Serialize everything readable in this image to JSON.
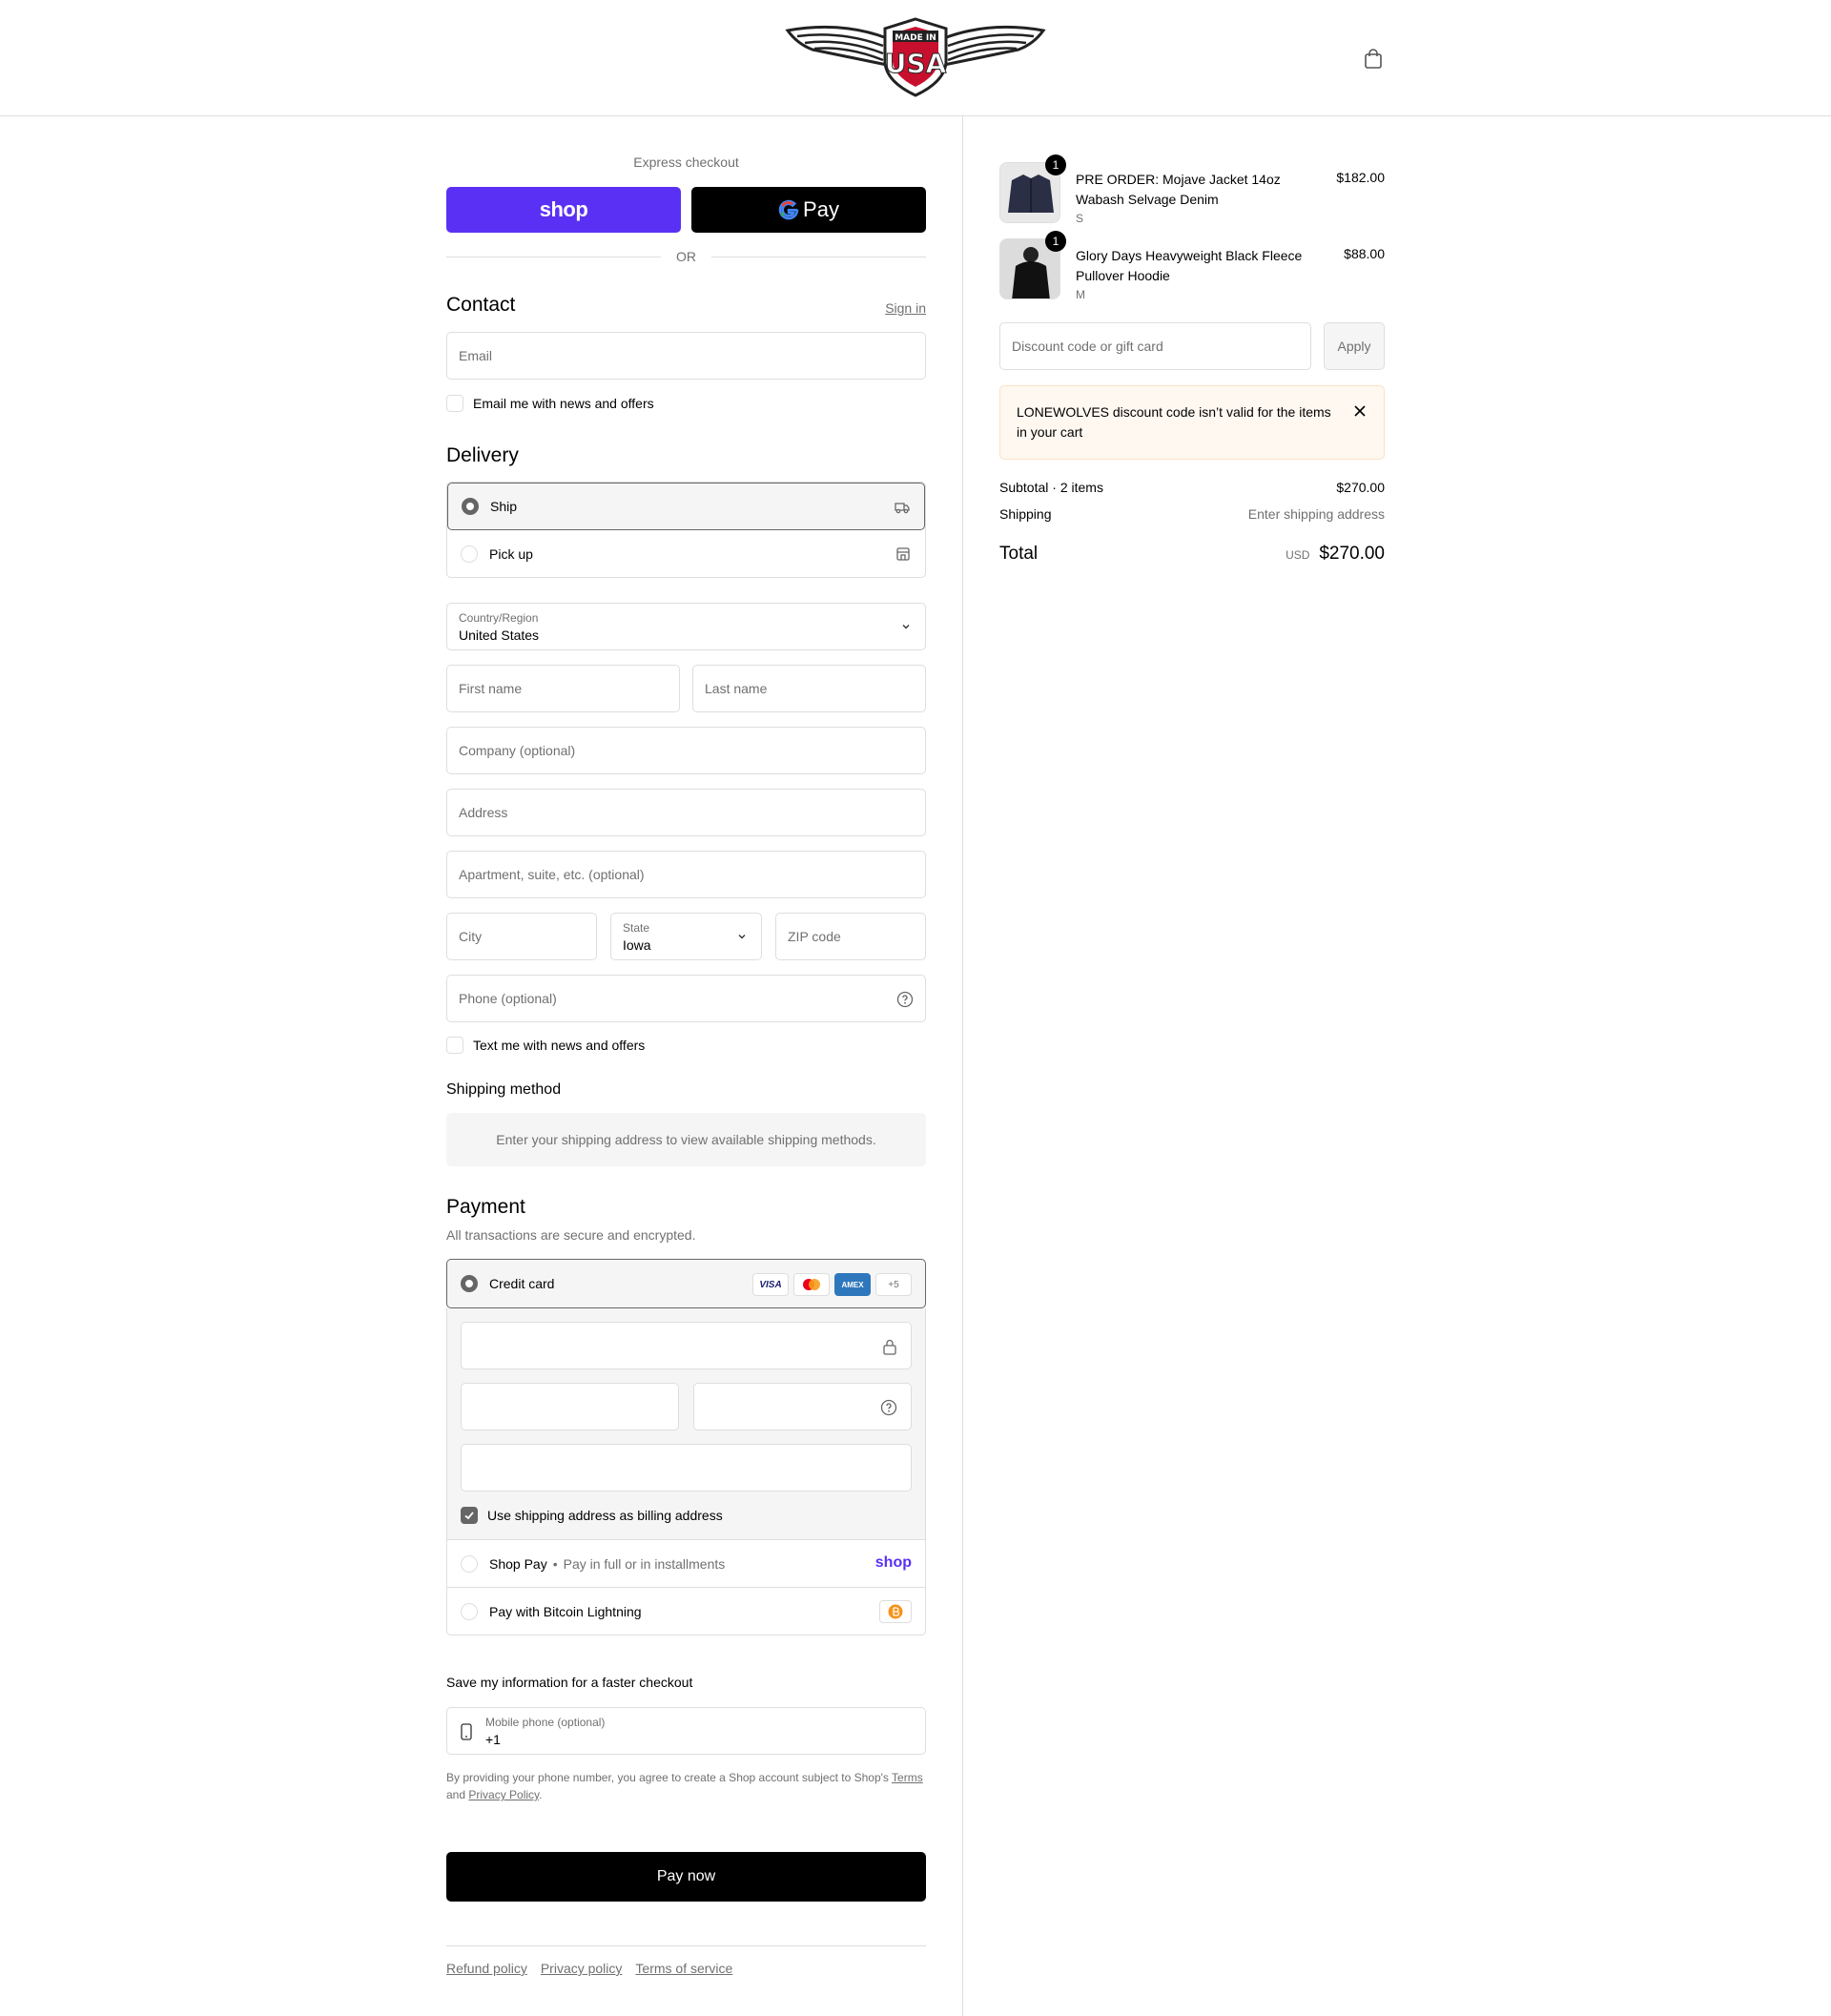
{
  "header": {
    "logo_text": "MADE IN USA"
  },
  "express": {
    "title": "Express checkout",
    "shop_label": "shop",
    "gpay_label": "Pay",
    "or_label": "OR"
  },
  "contact": {
    "title": "Contact",
    "sign_in": "Sign in",
    "email_placeholder": "Email",
    "news_label": "Email me with news and offers"
  },
  "delivery": {
    "title": "Delivery",
    "options": [
      {
        "label": "Ship",
        "selected": true,
        "icon": "truck-icon"
      },
      {
        "label": "Pick up",
        "selected": false,
        "icon": "store-icon"
      }
    ],
    "country_label": "Country/Region",
    "country_value": "United States",
    "first_name": "First name",
    "last_name": "Last name",
    "company": "Company (optional)",
    "address": "Address",
    "apartment": "Apartment, suite, etc. (optional)",
    "city": "City",
    "state_label": "State",
    "state_value": "Iowa",
    "zip": "ZIP code",
    "phone": "Phone (optional)",
    "text_label": "Text me with news and offers"
  },
  "shipping_method": {
    "title": "Shipping method",
    "message": "Enter your shipping address to view available shipping methods."
  },
  "payment": {
    "title": "Payment",
    "subtitle": "All transactions are secure and encrypted.",
    "credit_card": "Credit card",
    "cards": [
      "VISA",
      "MC",
      "AMEX",
      "+5"
    ],
    "billing_label": "Use shipping address as billing address",
    "shop_pay": "Shop Pay",
    "shop_pay_sub": "Pay in full or in installments",
    "shop_pay_logo": "shop",
    "bitcoin": "Pay with Bitcoin Lightning"
  },
  "save_info": {
    "title": "Save my information for a faster checkout",
    "mobile_label": "Mobile phone (optional)",
    "mobile_value": "+1",
    "legal_1": "By providing your phone number, you agree to create a Shop account subject to Shop's",
    "terms": "Terms",
    "and": "and",
    "privacy": "Privacy Policy",
    "period": "."
  },
  "pay_button": "Pay now",
  "footer": {
    "links": [
      "Refund policy",
      "Privacy policy",
      "Terms of service"
    ]
  },
  "cart": {
    "items": [
      {
        "qty": "1",
        "name": "PRE ORDER: Mojave Jacket 14oz Wabash Selvage Denim",
        "variant": "S",
        "price": "$182.00"
      },
      {
        "qty": "1",
        "name": "Glory Days Heavyweight Black Fleece Pullover Hoodie",
        "variant": "M",
        "price": "$88.00"
      }
    ],
    "discount_placeholder": "Discount code or gift card",
    "apply": "Apply",
    "alert": "LONEWOLVES discount code isn’t valid for the items in your cart",
    "subtotal_label": "Subtotal · 2 items",
    "subtotal_value": "$270.00",
    "shipping_label": "Shipping",
    "shipping_value": "Enter shipping address",
    "total_label": "Total",
    "currency": "USD",
    "total_value": "$270.00"
  },
  "colors": {
    "shop_purple": "#5a31f4",
    "alert_bg": "#fff8f1",
    "logo_red": "#c8102e"
  }
}
